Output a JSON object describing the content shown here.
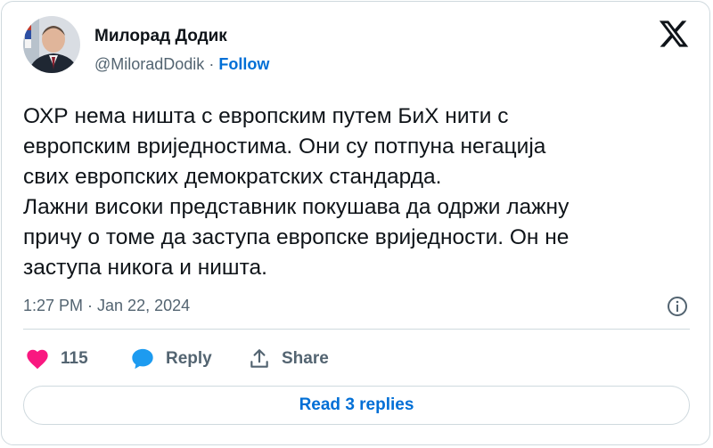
{
  "author": {
    "name": "Милорад Додик",
    "handle": "@MiloradDodik",
    "separator": "·",
    "follow_label": "Follow"
  },
  "tweet": {
    "text": "ОХР нема ништа с европским путем БиХ нити с\nевропским вриједностима. Они су потпуна негација\nсвих европских демократских стандарда.\nЛажни високи представник покушава да одржи лажну\nпричу о томе да заступа европске вриједности. Он не\nзаступа никога и ништа.",
    "timestamp": "1:27 PM · Jan 22, 2024"
  },
  "actions": {
    "like_count": "115",
    "reply_label": "Reply",
    "share_label": "Share"
  },
  "read_replies_label": "Read 3 replies",
  "icons": {
    "brand": "x-logo-icon",
    "like": "heart-icon",
    "reply": "speech-bubble-icon",
    "share": "share-upload-icon",
    "info": "info-icon"
  },
  "colors": {
    "like": "#f91880",
    "reply": "#1d9bf0",
    "link": "#006fd6",
    "secondary_text": "#536471",
    "border": "#cfd9de"
  }
}
